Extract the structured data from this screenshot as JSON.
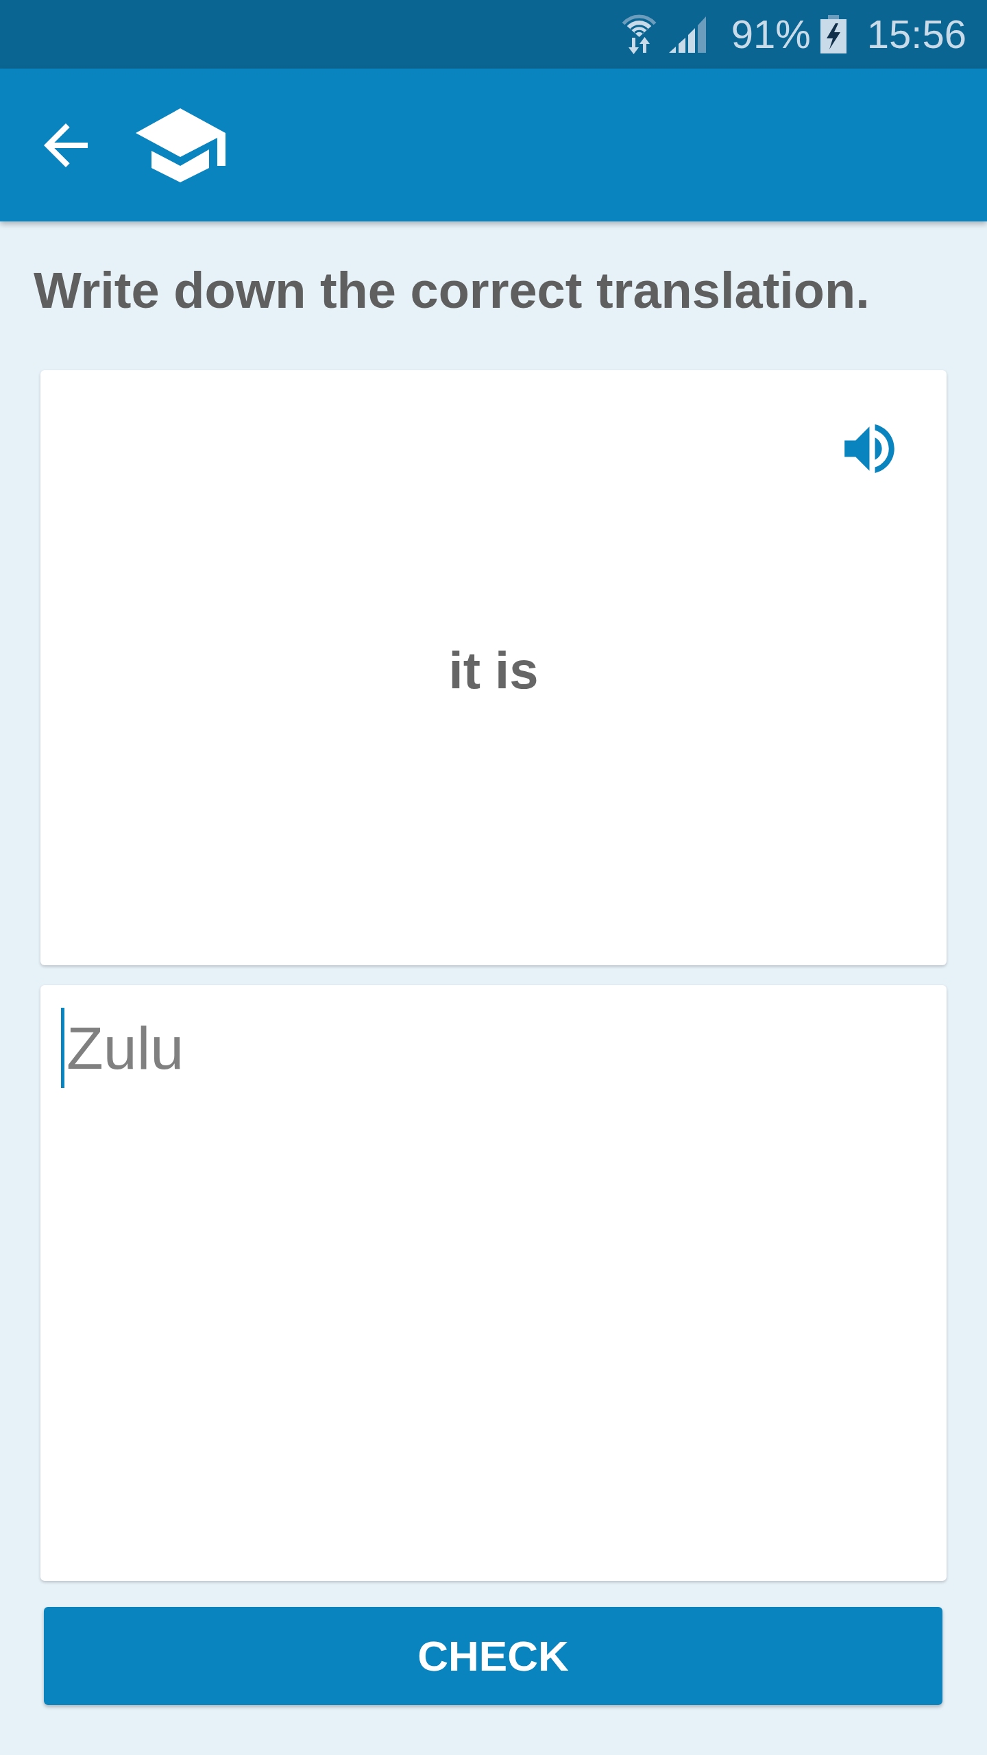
{
  "status_bar": {
    "battery": "91%",
    "time": "15:56"
  },
  "instruction": "Write down the correct translation.",
  "prompt": {
    "text": "it is"
  },
  "answer": {
    "placeholder": "Zulu",
    "focused": true
  },
  "check_button": {
    "label": "CHECK"
  }
}
